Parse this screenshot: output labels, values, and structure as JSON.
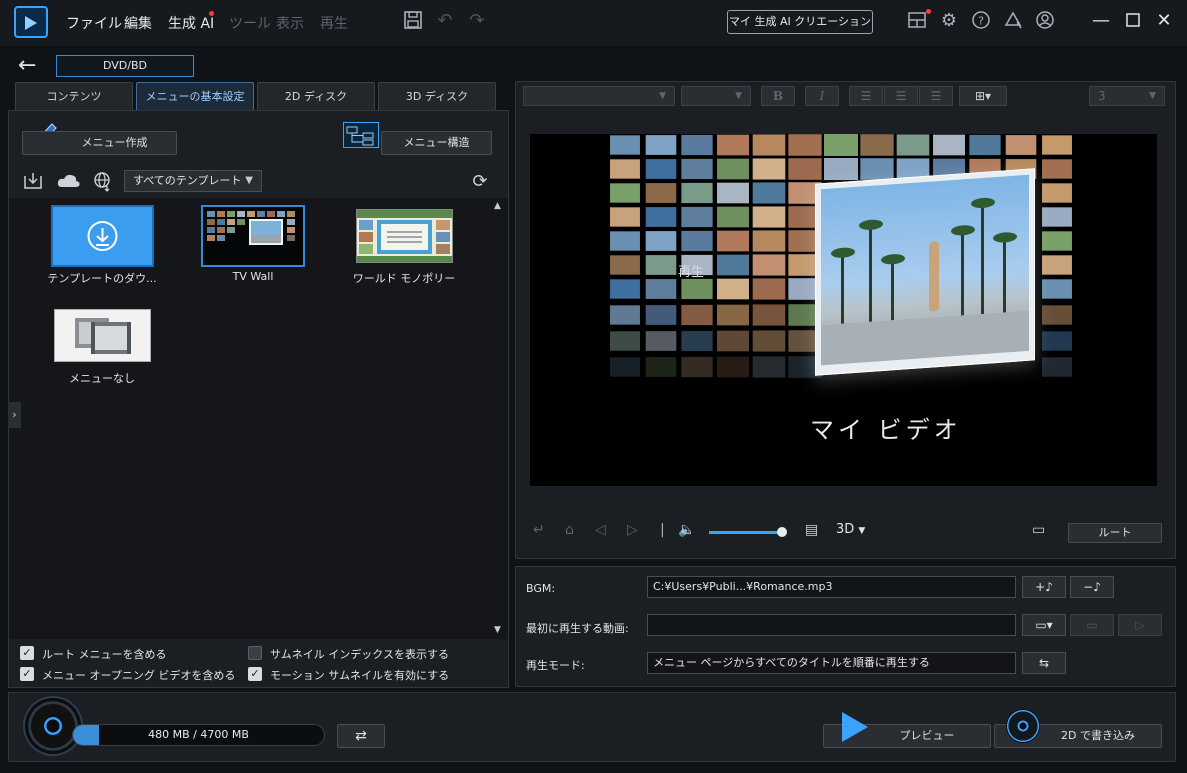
{
  "menubar": {
    "items": [
      "ファイル",
      "編集",
      "生成 AI",
      "ツール",
      "表示",
      "再生"
    ],
    "ai_creation_button": "マイ 生成 AI クリエーション"
  },
  "toolbar": {
    "icons": [
      "save-icon",
      "undo-icon",
      "redo-icon",
      "layout-icon",
      "settings-icon",
      "help-icon",
      "notification-icon",
      "account-icon",
      "minimize-icon",
      "maximize-icon",
      "close-icon"
    ]
  },
  "mode": {
    "label": "DVD/BD"
  },
  "tabs": [
    {
      "label": "コンテンツ",
      "active": false
    },
    {
      "label": "メニューの基本設定",
      "active": true
    },
    {
      "label": "2D ディスク",
      "active": false
    },
    {
      "label": "3D ディスク",
      "active": false
    }
  ],
  "left": {
    "menu_create": "メニュー作成",
    "menu_structure": "メニュー構造",
    "template_filter": "すべてのテンプレート",
    "templates": [
      {
        "label": "テンプレートのダウ..."
      },
      {
        "label": "TV Wall"
      },
      {
        "label": "ワールド モノポリー"
      },
      {
        "label": "メニューなし"
      }
    ],
    "options": [
      {
        "label": "ルート メニューを含める",
        "checked": true
      },
      {
        "label": "サムネイル インデックスを表示する",
        "checked": false
      },
      {
        "label": "メニュー オープニング ビデオを含める",
        "checked": true
      },
      {
        "label": "モーション サムネイルを有効にする",
        "checked": true
      }
    ]
  },
  "format_toolbar": {
    "font_size": "3"
  },
  "preview": {
    "title": "マイ ビデオ",
    "play_label": "再生",
    "view_mode": "3D",
    "root_button": "ルート",
    "volume": 1.0
  },
  "settings": {
    "bgm_label": "BGM:",
    "bgm_value": "C:¥Users¥Publi...¥Romance.mp3",
    "first_video_label": "最初に再生する動画:",
    "first_video_value": "",
    "playmode_label": "再生モード:",
    "playmode_value": "メニュー ページからすべてのタイトルを順番に再生する"
  },
  "bottom": {
    "capacity_text": "480 MB / 4700 MB",
    "capacity_fraction": 0.102,
    "preview_button": "プレビュー",
    "burn_button": "2D で書き込み"
  },
  "colors": {
    "accent": "#3aa2ff",
    "background": "#0f1216",
    "panel": "#1b1e22"
  }
}
